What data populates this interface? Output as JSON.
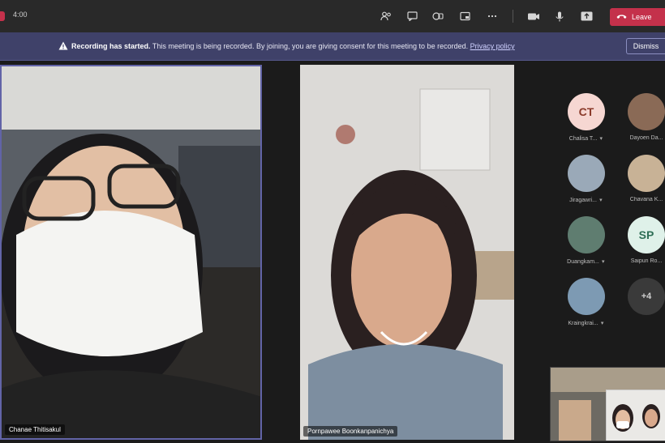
{
  "header": {
    "timer": "4:00",
    "leave_label": "Leave",
    "icons": [
      "participants-icon",
      "chat-icon",
      "reactions-icon",
      "rooms-icon",
      "more-icon",
      "camera-icon",
      "mic-icon",
      "share-icon",
      "phone-hangup-icon"
    ]
  },
  "banner": {
    "title": "Recording has started.",
    "message": "This meeting is being recorded. By joining, you are giving consent for this meeting to be recorded.",
    "link": "Privacy policy",
    "dismiss": "Dismiss"
  },
  "stage": {
    "left_tile": {
      "name": "Chanae Thitisakul"
    },
    "middle_tile": {
      "name": "Pornpawee Boonkanpanichya"
    }
  },
  "roster": [
    {
      "initials": "CT",
      "name": "Chalisa T...",
      "avatar_color": "#f6d7d2",
      "initials_color": "#8a3a2a"
    },
    {
      "initials": "",
      "name": "Dayoen Da...",
      "avatar_color": "#8a6a56"
    },
    {
      "initials": "",
      "name": "Jiragawri...",
      "avatar_color": "#9aa9b8"
    },
    {
      "initials": "",
      "name": "Chavana K...",
      "avatar_color": "#c8b296"
    },
    {
      "initials": "",
      "name": "Duangkam...",
      "avatar_color": "#5f7d70"
    },
    {
      "initials": "SP",
      "name": "Saipun Ro...",
      "avatar_color": "#dff1e9",
      "initials_color": "#2f6f56"
    },
    {
      "initials": "",
      "name": "Kraingkrai...",
      "avatar_color": "#7d9ab3"
    },
    {
      "initials": "+4",
      "name": "",
      "avatar_color": "#3a3a3a",
      "initials_color": "#cfcfcf"
    }
  ],
  "colors": {
    "accent": "#6264a7",
    "leave": "#c4314b",
    "banner": "#3f4169"
  }
}
